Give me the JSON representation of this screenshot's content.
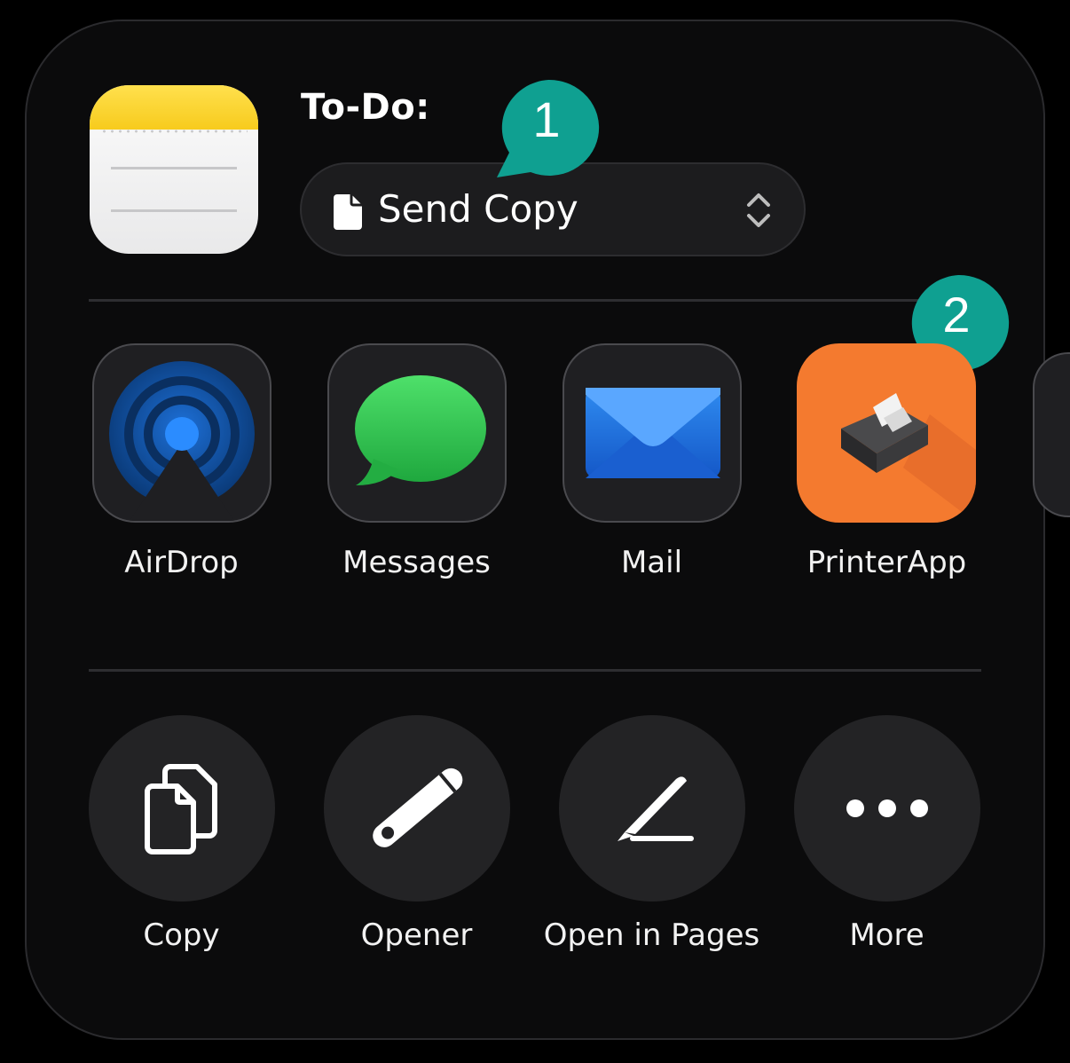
{
  "header": {
    "title": "To-Do:",
    "picker_label": "Send Copy"
  },
  "callouts": [
    "1",
    "2"
  ],
  "apps": [
    {
      "label": "AirDrop"
    },
    {
      "label": "Messages"
    },
    {
      "label": "Mail"
    },
    {
      "label": "PrinterApp"
    }
  ],
  "actions": [
    {
      "label": "Copy"
    },
    {
      "label": "Opener"
    },
    {
      "label": "Open in Pages"
    },
    {
      "label": "More"
    }
  ],
  "colors": {
    "callout": "#0fa091",
    "printer_orange": "#f47a2f",
    "sheet_bg": "#0b0b0c"
  }
}
